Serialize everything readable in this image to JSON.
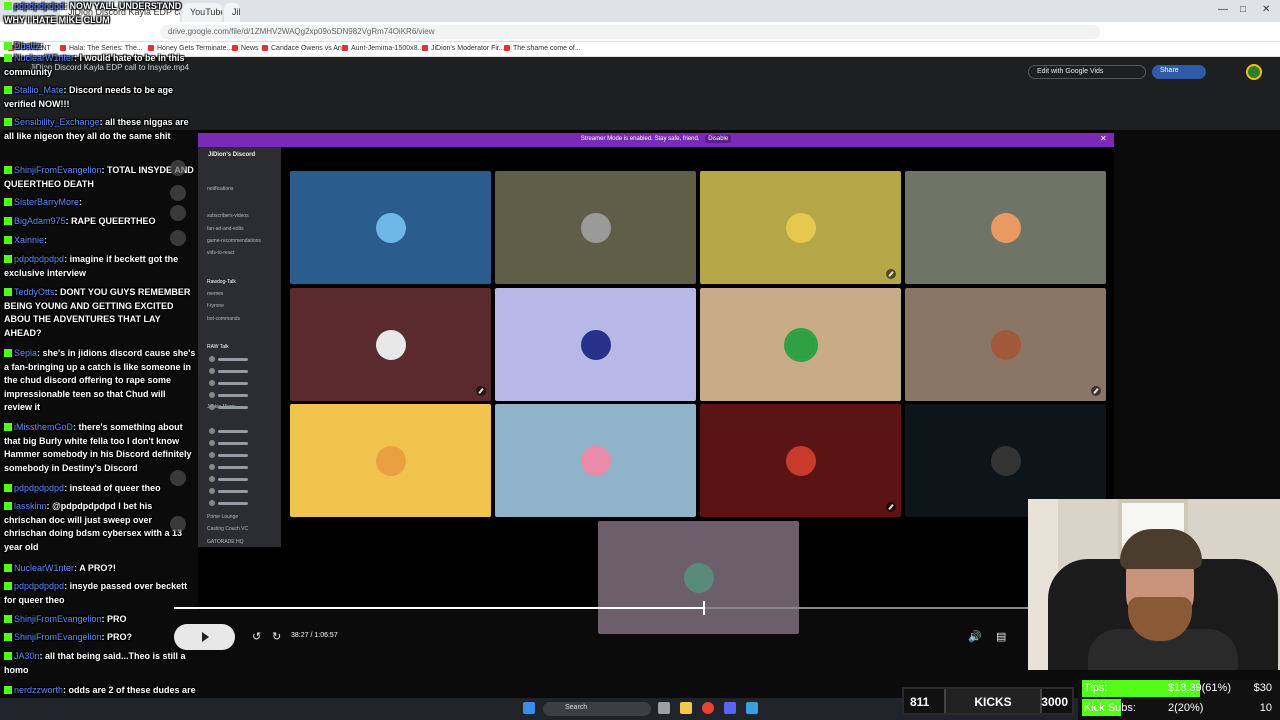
{
  "browser": {
    "tabs": [
      "JiDion Discord Kayla EDP call to Insyde.mp4",
      "YouTube",
      "JiDion Discord Kayla call to Insyde"
    ],
    "url": "drive.google.com/file/d/1ZMHV2WAQg2xp09oSDN982VgRm74OiKR6/view",
    "bookmarks": [
      "CONTENT",
      "Hala: The Series: The...",
      "Honey Gets Terminate...",
      "News",
      "Candace Owens vs An...",
      "Aunt-Jemima-1500x8...",
      "JiDion's Moderator Fir...",
      "The shame come of..."
    ]
  },
  "drive": {
    "file_title": "JiDion Discord Kayla EDP call to Insyde.mp4",
    "edit_with_vids_label": "Edit with Google Vids",
    "share_label": "Share"
  },
  "video": {
    "streamer_banner": "Streamer Mode is enabled. Stay safe, friend.",
    "disable_label": "Disable",
    "timecode": "38:27 / 1:06:57",
    "progress_fraction": 0.62
  },
  "discord": {
    "server_name": "JiDion's Discord",
    "channels": [
      "notifications",
      "subscribers-videos",
      "fan-art-and-edits",
      "game-recommendations",
      "vids-to-react",
      "Rawdog-Talk",
      "memes",
      "f-tyrone",
      "bot-commands",
      "RAW Talk",
      "Jackie Music",
      "Prime Lounge",
      "Casting Couch VC",
      "GATORADE HQ"
    ],
    "tile_colors": [
      "#2a5c8e",
      "#5f5e48",
      "#b5a748",
      "#6f7466",
      "#5b2a2e",
      "#b7b7e8",
      "#c8ac88",
      "#8a7666",
      "#f0c24e",
      "#8fb3c8",
      "#5a1414",
      "#0d1519",
      "#6c5e6a"
    ],
    "avatar_colors": [
      "#6eb8e8",
      "#9a9a9a",
      "#e6c84e",
      "#e89a60",
      "#e8e8e8",
      "#26318a",
      "#2ea043",
      "#a05a3a",
      "#e8a040",
      "#e88aa8",
      "#c83a2a",
      "#333333",
      "#5a8a7a"
    ]
  },
  "chat": [
    {
      "user": "pdpdpdpdpd",
      "text": "NOW YALL UNDERSTAND WHY I HATE MIKE CLUM"
    },
    {
      "user": "Dbattz",
      "text": ""
    },
    {
      "user": "NuclearW1nter",
      "text": "I would hate to be in this community"
    },
    {
      "user": "Stallio_Mate",
      "text": "Discord needs to be age verified NOW!!!"
    },
    {
      "user": "Sensibility_Exchange",
      "text": "all these niggas are all like nigeon they all do the same shit"
    },
    {
      "user": "ShinjiFromEvangelion",
      "text": "TOTAL INSYDE AND QUEERTHEO DEATH"
    },
    {
      "user": "SisterBarryMore",
      "text": ""
    },
    {
      "user": "BigAdam975",
      "text": "RAPE QUEERTHEO"
    },
    {
      "user": "Xainnie",
      "text": ""
    },
    {
      "user": "pdpdpdpdpd",
      "text": "imagine if beckett got the exclusive interview"
    },
    {
      "user": "TeddyOtts",
      "text": "DONT YOU GUYS REMEMBER BEING YOUNG AND GETTING EXCITED ABOU THE ADVENTURES THAT LAY AHEAD?"
    },
    {
      "user": "Sepia",
      "text": "she's in jidions discord cause she's a fan-bringing up a catch is like someone in the chud discord offering to rape some impressionable teen so that Chud will review it"
    },
    {
      "user": "iMissthemGoD",
      "text": "there's something about that big Burly white fella too I don't know Hammer somebody in his Discord definitely somebody in Destiny's Discord"
    },
    {
      "user": "pdpdpdpdpd",
      "text": "instead of queer theo"
    },
    {
      "user": "lasskinn",
      "text": "@pdpdpdpdpd I bet his chrischan doc will just sweep over chrischan doing bdsm cybersex with a 13 year old"
    },
    {
      "user": "NuclearW1nter",
      "text": "A PRO?!"
    },
    {
      "user": "pdpdpdpdpd",
      "text": "insyde passed over beckett for queer theo"
    },
    {
      "user": "ShinjiFromEvangelion",
      "text": "PRO"
    },
    {
      "user": "ShinjiFromEvangelion",
      "text": "PRO?"
    },
    {
      "user": "JA30n",
      "text": "all that being said...Theo is still a homo"
    },
    {
      "user": "nerdzzworth",
      "text": "odds are 2 of these dudes are pedos in the call"
    }
  ],
  "taskbar": {
    "search_label": "Search"
  },
  "stats": {
    "kicks_current": "811",
    "kicks_label": "KICKS",
    "kicks_goal": "3000",
    "tips_label": "Tips:",
    "tips_value": "$18.39(61%)",
    "tips_goal": "$30",
    "tips_fraction": 0.61,
    "subs_label": "Kick Subs:",
    "subs_value": "2(20%)",
    "subs_goal": "10",
    "subs_fraction": 0.2
  }
}
